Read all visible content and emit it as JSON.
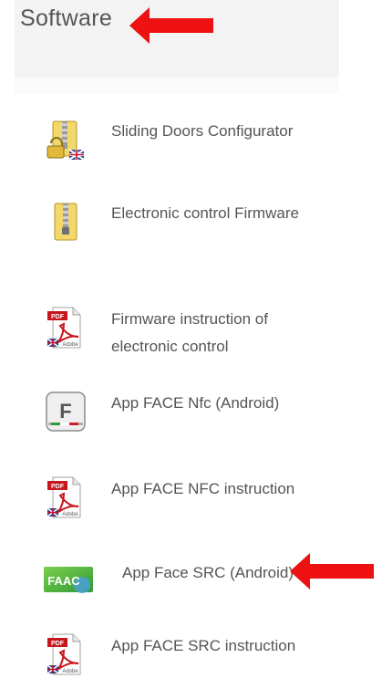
{
  "page": {
    "title": "Software"
  },
  "items": [
    {
      "label": "Sliding Doors Configurator",
      "icon": "zip-folder-lock-uk-icon"
    },
    {
      "label": "Electronic control Firmware",
      "icon": "zip-folder-icon"
    },
    {
      "label": "Firmware instruction of electronic control",
      "icon": "pdf-uk-icon"
    },
    {
      "label": "App FACE Nfc (Android)",
      "icon": "app-face-nfc-icon"
    },
    {
      "label": "App FACE NFC instruction",
      "icon": "pdf-uk-icon"
    },
    {
      "label": "App Face SRC (Android)",
      "icon": "app-face-src-icon"
    },
    {
      "label": "App FACE SRC instruction",
      "icon": "pdf-uk-icon"
    }
  ],
  "icon_text": {
    "pdf": "PDF",
    "adobe": "Adobe",
    "nfc_letter": "F",
    "src_logo": "FAAC"
  },
  "annotations": [
    {
      "name": "title-arrow",
      "color": "#ee1111"
    },
    {
      "name": "app-face-src-arrow",
      "color": "#ee1111"
    }
  ]
}
